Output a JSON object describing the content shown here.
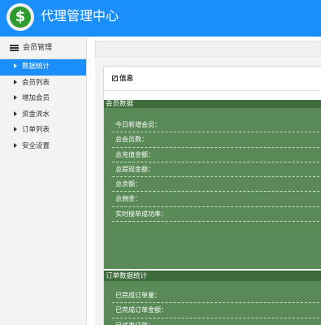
{
  "app": {
    "title": "代理管理中心",
    "logo_icon": "dollar-coin-icon",
    "logo_glyph": "$",
    "accent": "#1a8ffc"
  },
  "sidebar": {
    "header": "会员管理",
    "items": [
      {
        "label": "数据统计",
        "active": true
      },
      {
        "label": "会员列表"
      },
      {
        "label": "增加会员"
      },
      {
        "label": "资金流水"
      },
      {
        "label": "订单列表"
      },
      {
        "label": "安全设置"
      }
    ]
  },
  "panel": {
    "title": "信息",
    "member_section": {
      "title": "会员数据",
      "rows": [
        "今日新增会员：",
        "总会员数：",
        "总充值金额：",
        "总提现金额：",
        "总余额：",
        "总佣金：",
        "实时接单成功率："
      ]
    },
    "order_section": {
      "title": "订单数据统计",
      "rows": [
        "已完成订单量：",
        "已完成订单金额：",
        "已派发订单："
      ]
    }
  }
}
